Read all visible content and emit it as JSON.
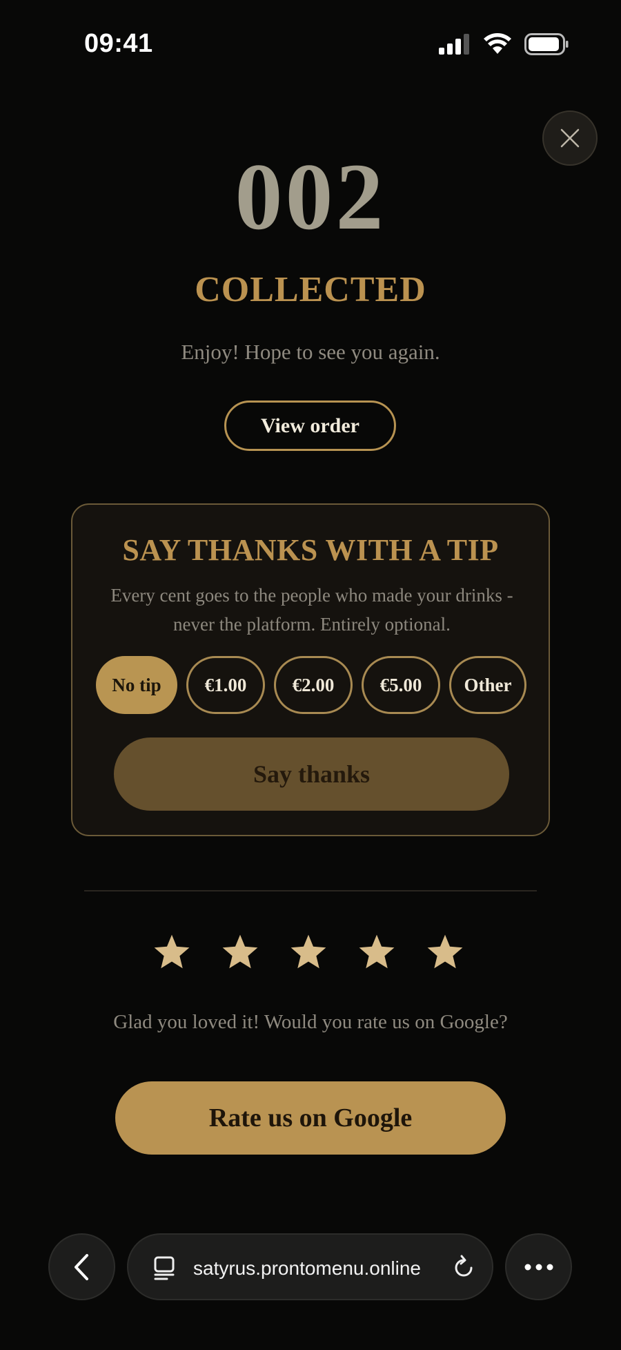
{
  "status_bar": {
    "time": "09:41",
    "icons": [
      "signal-icon",
      "wifi-icon",
      "battery-icon"
    ]
  },
  "close_icon": "close-icon",
  "order": {
    "number": "002",
    "status": "COLLECTED",
    "message": "Enjoy! Hope to see you again.",
    "view_order_label": "View order"
  },
  "tip": {
    "title": "SAY THANKS WITH A TIP",
    "description": "Every cent goes to the people who made your drinks - never the platform. Entirely optional.",
    "options": [
      {
        "label": "No tip",
        "selected": true
      },
      {
        "label": "€1.00",
        "selected": false
      },
      {
        "label": "€2.00",
        "selected": false
      },
      {
        "label": "€5.00",
        "selected": false
      },
      {
        "label": "Other",
        "selected": false
      }
    ],
    "submit_label": "Say thanks"
  },
  "rating": {
    "stars_filled": 5,
    "stars_total": 5,
    "message": "Glad you loved it! Would you rate us on Google?",
    "google_button_label": "Rate us on Google"
  },
  "browser": {
    "url": "satyrus.prontomenu.online",
    "icons": [
      "back-icon",
      "tabs-icon",
      "reload-icon",
      "more-icon"
    ]
  },
  "colors": {
    "background": "#080807",
    "accent_gold": "#b99352",
    "muted_text": "#8f8a80",
    "card_border": "#6b5a38"
  }
}
